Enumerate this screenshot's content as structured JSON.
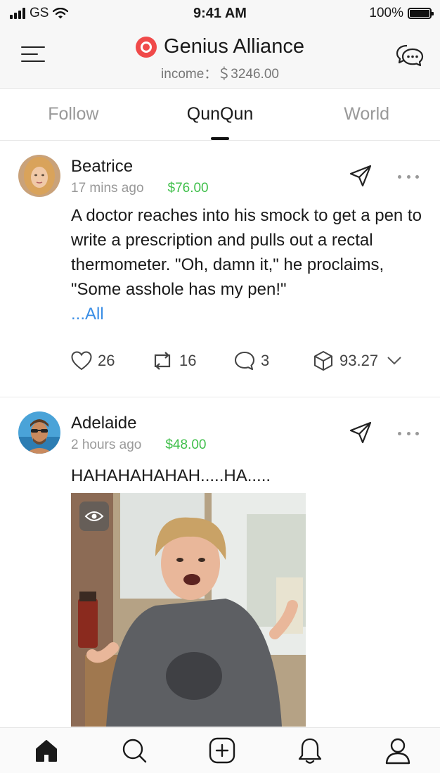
{
  "status_bar": {
    "carrier": "GS",
    "time": "9:41 AM",
    "battery": "100%",
    "battery_level": 1.0
  },
  "header": {
    "title": "Genius Alliance",
    "income": "income：＄3246.00",
    "icons": {
      "menu": "menu-icon",
      "logo": "brand-logo-icon",
      "chat": "chat-bubbles-icon"
    },
    "brand_color": "#f04a4a"
  },
  "tabs": [
    {
      "label": "Follow"
    },
    {
      "label": "QunQun"
    },
    {
      "label": "World"
    }
  ],
  "active_tab": "QunQun",
  "posts": [
    {
      "username": "Beatrice",
      "time": "17 mins ago",
      "reward": "$76.00",
      "text": "A doctor reaches into his smock to get a pen to write a prescription and pulls out a rectal thermometer. \"Oh, damn it,\" he proclaims, \"Some asshole has my pen!\"",
      "read_all": "...All",
      "stats": {
        "likes": "26",
        "reposts": "16",
        "comments": "3",
        "value": "93.27"
      }
    },
    {
      "username": "Adelaide",
      "time": "2 hours ago",
      "reward": "$48.00",
      "text": "HAHAHAHAHAH.....HA....."
    }
  ],
  "colors": {
    "reward_green": "#3fbf4a",
    "link_blue": "#3a8ee6",
    "inactive_tab": "#999999"
  },
  "bottom_nav": [
    {
      "icon": "home-icon",
      "active": true
    },
    {
      "icon": "search-icon"
    },
    {
      "icon": "add-post-icon"
    },
    {
      "icon": "bell-icon"
    },
    {
      "icon": "profile-icon"
    }
  ]
}
